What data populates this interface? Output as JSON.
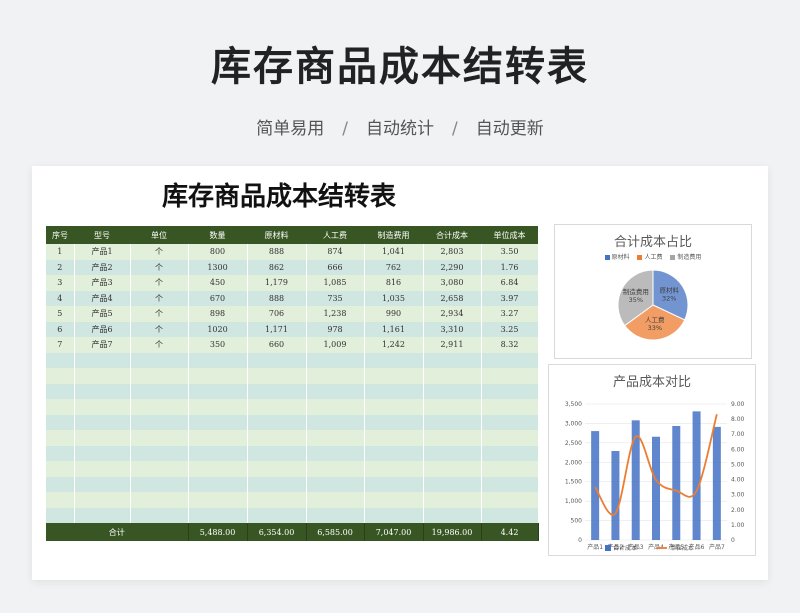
{
  "hero": {
    "title": "库存商品成本结转表",
    "sub": [
      "简单易用",
      "自动统计",
      "自动更新"
    ],
    "sep": "/"
  },
  "sheet": {
    "title": "库存商品成本结转表",
    "headers": [
      "序号",
      "型号",
      "单位",
      "数量",
      "原材料",
      "人工费",
      "制造费用",
      "合计成本",
      "单位成本"
    ],
    "rows": [
      [
        "1",
        "产品1",
        "个",
        "800",
        "888",
        "874",
        "1,041",
        "2,803",
        "3.50"
      ],
      [
        "2",
        "产品2",
        "个",
        "1300",
        "862",
        "666",
        "762",
        "2,290",
        "1.76"
      ],
      [
        "3",
        "产品3",
        "个",
        "450",
        "1,179",
        "1,085",
        "816",
        "3,080",
        "6.84"
      ],
      [
        "4",
        "产品4",
        "个",
        "670",
        "888",
        "735",
        "1,035",
        "2,658",
        "3.97"
      ],
      [
        "5",
        "产品5",
        "个",
        "898",
        "706",
        "1,238",
        "990",
        "2,934",
        "3.27"
      ],
      [
        "6",
        "产品6",
        "个",
        "1020",
        "1,171",
        "978",
        "1,161",
        "3,310",
        "3.25"
      ],
      [
        "7",
        "产品7",
        "个",
        "350",
        "660",
        "1,009",
        "1,242",
        "2,911",
        "8.32"
      ]
    ],
    "total": [
      "合计",
      "5,488.00",
      "6,354.00",
      "6,585.00",
      "7,047.00",
      "19,986.00",
      "4.42"
    ]
  },
  "colors": {
    "header": "#375623",
    "blue": "#4472c4",
    "orange": "#ed7d31",
    "gray": "#a5a5a5"
  },
  "chart_data": [
    {
      "type": "pie",
      "title": "合计成本占比",
      "categories": [
        "原材料",
        "人工费",
        "制造费用"
      ],
      "values": [
        32,
        33,
        35
      ],
      "labels": [
        "原材料\n32%",
        "人工费\n33%",
        "制造费用\n35%"
      ]
    },
    {
      "type": "bar",
      "title": "产品成本对比",
      "categories": [
        "产品1",
        "产品2",
        "产品3",
        "产品4",
        "产品5",
        "产品6",
        "产品7"
      ],
      "series": [
        {
          "name": "合计成本",
          "values": [
            2803,
            2290,
            3080,
            2658,
            2934,
            3310,
            2911
          ],
          "axis": "left",
          "kind": "bar"
        },
        {
          "name": "单位成本",
          "values": [
            3.5,
            1.76,
            6.84,
            3.97,
            3.27,
            3.25,
            8.32
          ],
          "axis": "right",
          "kind": "line"
        }
      ],
      "ylim": [
        0,
        3500
      ],
      "yticks": [
        "0",
        "500",
        "1,000",
        "1,500",
        "2,000",
        "2,500",
        "3,000",
        "3,500"
      ],
      "y2lim": [
        0,
        9
      ],
      "y2ticks": [
        "0",
        "1.00",
        "2.00",
        "3.00",
        "4.00",
        "5.00",
        "6.00",
        "7.00",
        "8.00",
        "9.00"
      ]
    }
  ]
}
